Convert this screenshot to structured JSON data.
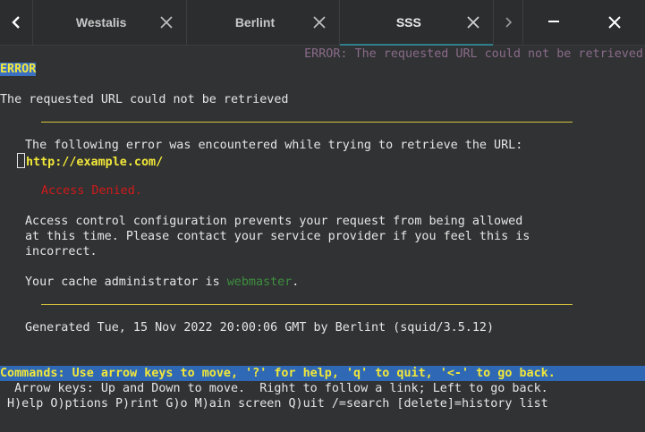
{
  "tabs": [
    {
      "label": "Westalis",
      "active": false
    },
    {
      "label": "Berlint",
      "active": false
    },
    {
      "label": "SSS",
      "active": true
    }
  ],
  "icons": {
    "back": "chevron-left-icon",
    "forward": "chevron-right-icon",
    "tab_close": "close-icon",
    "minimize": "minimize-icon",
    "window_close": "close-icon"
  },
  "colors": {
    "link_yellow": "#f2e73a",
    "status_blue": "#2f68b5",
    "denied_red": "#d11a1a",
    "webmaster_green": "#3f8f3f",
    "active_tab_underline": "#2f7f8c"
  },
  "page": {
    "title_right": "ERROR: The requested URL could not be retrieved",
    "error_tag": "ERROR",
    "heading": "The requested URL could not be retrieved",
    "intro": "The following error was encountered while trying to retrieve the URL:",
    "url": "http://example.com/",
    "denied": "Access Denied.",
    "desc_line1": "Access control configuration prevents your request from being allowed",
    "desc_line2": "at this time. Please contact your service provider if you feel this is",
    "desc_line3": "incorrect.",
    "admin_prefix": "Your cache administrator is ",
    "admin_link": "webmaster",
    "admin_suffix": ".",
    "generated": "Generated Tue, 15 Nov 2022 20:00:06 GMT by Berlint (squid/3.5.12)"
  },
  "status": {
    "commands": "Commands: Use arrow keys to move, '?' for help, 'q' to quit, '<-' to go back.",
    "arrow_help": "  Arrow keys: Up and Down to move.  Right to follow a link; Left to go back.",
    "menu": " H)elp O)ptions P)rint G)o M)ain screen Q)uit /=search [delete]=history list"
  }
}
